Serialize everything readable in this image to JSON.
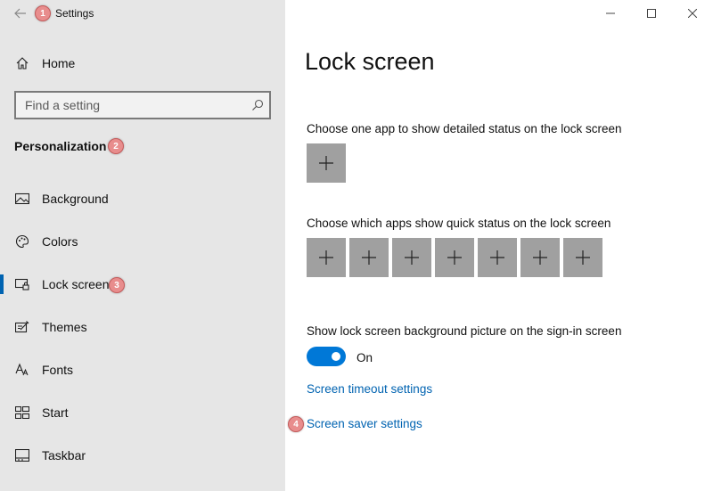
{
  "app": {
    "title": "Settings"
  },
  "badges": {
    "b1": "1",
    "b2": "2",
    "b3": "3",
    "b4": "4"
  },
  "sidebar": {
    "home_label": "Home",
    "search_placeholder": "Find a setting",
    "section_title": "Personalization",
    "items": [
      {
        "label": "Background",
        "icon": "background-icon"
      },
      {
        "label": "Colors",
        "icon": "palette-icon"
      },
      {
        "label": "Lock screen",
        "icon": "lock-screen-icon",
        "selected": true
      },
      {
        "label": "Themes",
        "icon": "themes-icon"
      },
      {
        "label": "Fonts",
        "icon": "fonts-icon"
      },
      {
        "label": "Start",
        "icon": "start-icon"
      },
      {
        "label": "Taskbar",
        "icon": "taskbar-icon"
      }
    ]
  },
  "main": {
    "title": "Lock screen",
    "detailed_status_label": "Choose one app to show detailed status on the lock screen",
    "quick_status_label": "Choose which apps show quick status on the lock screen",
    "signin_bg_label": "Show lock screen background picture on the sign-in screen",
    "toggle_state": "On",
    "toggle_on": true,
    "timeout_link": "Screen timeout settings",
    "screensaver_link": "Screen saver settings"
  },
  "colors": {
    "accent": "#0078d7",
    "link": "#0063b1",
    "sidebar_bg": "#e6e6e6",
    "tile_bg": "#a0a0a0"
  }
}
